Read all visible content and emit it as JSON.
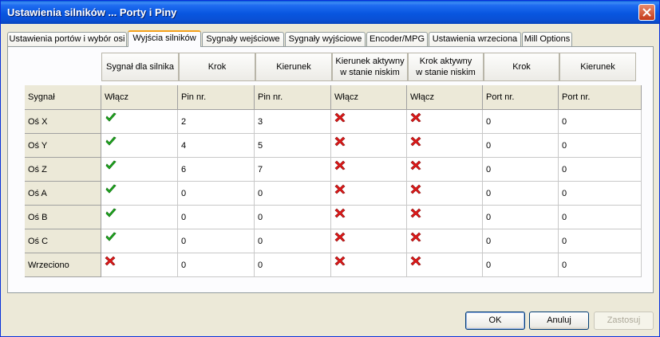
{
  "window": {
    "title": "Ustawienia silników ... Porty i Piny"
  },
  "tabs": [
    {
      "label": "Ustawienia portów i wybór osi"
    },
    {
      "label": "Wyjścia silników"
    },
    {
      "label": "Sygnały wejściowe"
    },
    {
      "label": "Sygnały wyjściowe"
    },
    {
      "label": "Encoder/MPG"
    },
    {
      "label": "Ustawienia wrzeciona"
    },
    {
      "label": "Mill Options"
    }
  ],
  "active_tab": 1,
  "group_headers": [
    "Sygnał dla silnika",
    "Krok",
    "Kierunek",
    "Kierunek aktywny\nw stanie niskim",
    "Krok aktywny\nw stanie niskim",
    "Krok",
    "Kierunek"
  ],
  "table": {
    "columns": [
      "Sygnał",
      "Włącz",
      "Pin nr.",
      "Pin nr.",
      "Włącz",
      "Włącz",
      "Port nr.",
      "Port nr."
    ],
    "rows": [
      {
        "signal": "Oś X",
        "enabled": true,
        "step_pin": "2",
        "dir_pin": "3",
        "dir_low": false,
        "step_low": false,
        "step_port": "0",
        "dir_port": "0"
      },
      {
        "signal": "Oś Y",
        "enabled": true,
        "step_pin": "4",
        "dir_pin": "5",
        "dir_low": false,
        "step_low": false,
        "step_port": "0",
        "dir_port": "0"
      },
      {
        "signal": "Oś Z",
        "enabled": true,
        "step_pin": "6",
        "dir_pin": "7",
        "dir_low": false,
        "step_low": false,
        "step_port": "0",
        "dir_port": "0"
      },
      {
        "signal": "Oś A",
        "enabled": true,
        "step_pin": "0",
        "dir_pin": "0",
        "dir_low": false,
        "step_low": false,
        "step_port": "0",
        "dir_port": "0"
      },
      {
        "signal": "Oś B",
        "enabled": true,
        "step_pin": "0",
        "dir_pin": "0",
        "dir_low": false,
        "step_low": false,
        "step_port": "0",
        "dir_port": "0"
      },
      {
        "signal": "Oś C",
        "enabled": true,
        "step_pin": "0",
        "dir_pin": "0",
        "dir_low": false,
        "step_low": false,
        "step_port": "0",
        "dir_port": "0"
      },
      {
        "signal": "Wrzeciono",
        "enabled": false,
        "step_pin": "0",
        "dir_pin": "0",
        "dir_low": false,
        "step_low": false,
        "step_port": "0",
        "dir_port": "0"
      }
    ]
  },
  "icons": {
    "enabled": "green-check-icon",
    "disabled": "red-x-icon"
  },
  "colors": {
    "check": "#22b222",
    "cross": "#e01818",
    "accent": "#f5a11a"
  },
  "buttons": {
    "ok": "OK",
    "cancel": "Anuluj",
    "apply": "Zastosuj"
  }
}
